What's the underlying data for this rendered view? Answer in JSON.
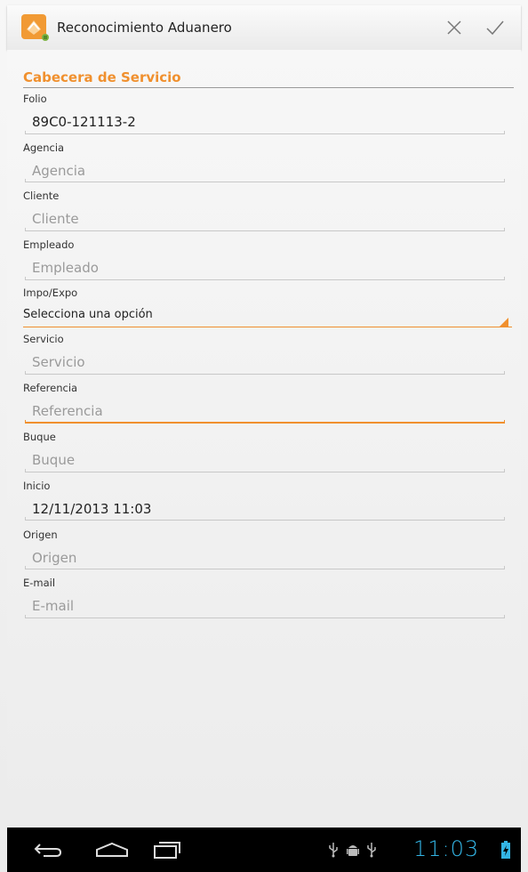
{
  "app": {
    "title": "Reconocimiento Aduanero",
    "icon": "app-logo-icon",
    "actions": [
      {
        "name": "close-icon"
      },
      {
        "name": "checkmark-icon"
      }
    ]
  },
  "form": {
    "section_title": "Cabecera de Servicio",
    "fields": {
      "folio": {
        "label": "Folio",
        "value": "89C0-121113-2"
      },
      "agencia": {
        "label": "Agencia",
        "placeholder": "Agencia"
      },
      "cliente": {
        "label": "Cliente",
        "placeholder": "Cliente"
      },
      "empleado": {
        "label": "Empleado",
        "placeholder": "Empleado"
      },
      "impo_expo": {
        "label": "Impo/Expo",
        "selected": "Selecciona una opción"
      },
      "servicio": {
        "label": "Servicio",
        "placeholder": "Servicio"
      },
      "referencia": {
        "label": "Referencia",
        "placeholder": "Referencia"
      },
      "buque": {
        "label": "Buque",
        "placeholder": "Buque"
      },
      "inicio": {
        "label": "Inicio",
        "value": "12/11/2013 11:03"
      },
      "origen": {
        "label": "Origen",
        "placeholder": "Origen"
      },
      "email": {
        "label": "E-mail",
        "placeholder": "E-mail"
      }
    }
  },
  "statusbar": {
    "time": "11:03",
    "icons": [
      "usb-icon",
      "android-debug-icon",
      "usb-icon",
      "battery-charging-icon"
    ]
  },
  "navbar": {
    "buttons": [
      "back-icon",
      "home-icon",
      "recent-apps-icon"
    ]
  },
  "colors": {
    "accent": "#f0902e",
    "holo_blue": "#33b5e5"
  }
}
